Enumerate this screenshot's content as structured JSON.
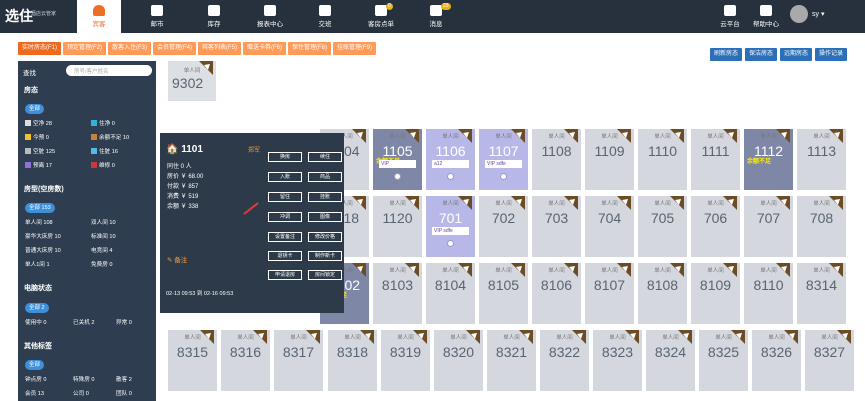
{
  "app": {
    "logo": "选住",
    "logo_sub": "酒店云管家",
    "user": "sy"
  },
  "nav": [
    {
      "label": "宾客",
      "active": true
    },
    {
      "label": "邮市"
    },
    {
      "label": "库存"
    },
    {
      "label": "报表中心"
    },
    {
      "label": "交班"
    },
    {
      "label": "客房点单",
      "badge": "0"
    },
    {
      "label": "消息",
      "badge": "23"
    }
  ],
  "nav_right": [
    "云平台",
    "帮助中心"
  ],
  "tabs": [
    "实时房态(F1)",
    "预定管理(F2)",
    "散客入住(F3)",
    "会员管理(F4)",
    "宾客列表(F5)",
    "赠送卡券(F6)",
    "保住管理(F8)",
    "挂账管理(F9)"
  ],
  "actions": [
    "刷新房态",
    "保洁房态",
    "远期房态",
    "操作记录"
  ],
  "sidebar": {
    "search_label": "查找",
    "search_placeholder": "房号/客户姓名",
    "room_status_title": "房态",
    "all": "全部",
    "status": [
      "空净 28",
      "住净 0",
      "今预 0",
      "余额不足 10",
      "空脏 125",
      "住脏 16",
      "预离 17",
      "维修 0"
    ],
    "roomtype_title": "房型(空房数)",
    "roomtype_all": "全部 153",
    "roomtypes": [
      "单人间 108",
      "双人间 10",
      "豪华大床房 10",
      "标准间 10",
      "普通大床房 10",
      "电竞间 4",
      "单人1间 1",
      "免费房 0"
    ],
    "power_title": "电脑状态",
    "power_all": "全部 2",
    "power": [
      "使用中 0",
      "已关机 2",
      "异常 0"
    ],
    "other_title": "其他标签",
    "other_all": "全部",
    "other": [
      "钟点房 0",
      "特殊房 0",
      "散客 2",
      "会员 13",
      "公司 0",
      "团队 0"
    ]
  },
  "rooms_top": {
    "type": "单人间",
    "no": "9302"
  },
  "rooms": [
    {
      "no": "1104",
      "type": "单人间"
    },
    {
      "no": "1105",
      "type": "单人间",
      "tag": "余额不足",
      "vip": "VIP"
    },
    {
      "no": "1106",
      "type": "单人间",
      "vip": "a12"
    },
    {
      "no": "1107",
      "type": "单人间",
      "vip": "VIP sdfe"
    },
    {
      "no": "1108",
      "type": "单人间"
    },
    {
      "no": "1109",
      "type": "单人间"
    },
    {
      "no": "1110",
      "type": "单人间"
    },
    {
      "no": "1111",
      "type": "单人间"
    },
    {
      "no": "1112",
      "type": "单人间",
      "tag": "余额不足"
    },
    {
      "no": "1113",
      "type": "单人间"
    },
    {
      "no": "1118",
      "type": "单人间"
    },
    {
      "no": "1120",
      "type": "单人间"
    },
    {
      "no": "701",
      "type": "单人间",
      "vip": "VIP sdfe"
    },
    {
      "no": "702",
      "type": "单人间"
    },
    {
      "no": "703",
      "type": "单人间"
    },
    {
      "no": "704",
      "type": "单人间"
    },
    {
      "no": "705",
      "type": "单人间"
    },
    {
      "no": "706",
      "type": "单人间"
    },
    {
      "no": "707",
      "type": "单人间"
    },
    {
      "no": "708",
      "type": "单人间"
    },
    {
      "no": "8102",
      "type": "单人间",
      "tag": "余额不足"
    },
    {
      "no": "8103",
      "type": "单人间"
    },
    {
      "no": "8104",
      "type": "单人间"
    },
    {
      "no": "8105",
      "type": "单人间"
    },
    {
      "no": "8106",
      "type": "单人间"
    },
    {
      "no": "8107",
      "type": "单人间"
    },
    {
      "no": "8108",
      "type": "单人间"
    },
    {
      "no": "8109",
      "type": "单人间"
    },
    {
      "no": "8110",
      "type": "单人间"
    },
    {
      "no": "8314",
      "type": "单人间"
    },
    {
      "no": "8315",
      "type": "单人间"
    },
    {
      "no": "8316",
      "type": "单人间"
    },
    {
      "no": "8317",
      "type": "单人间"
    },
    {
      "no": "8318",
      "type": "单人间"
    },
    {
      "no": "8319",
      "type": "单人间"
    },
    {
      "no": "8320",
      "type": "单人间"
    },
    {
      "no": "8321",
      "type": "单人间"
    },
    {
      "no": "8322",
      "type": "单人间"
    },
    {
      "no": "8323",
      "type": "单人间"
    },
    {
      "no": "8324",
      "type": "单人间"
    },
    {
      "no": "8325",
      "type": "单人间"
    },
    {
      "no": "8326",
      "type": "单人间"
    },
    {
      "no": "8327",
      "type": "单人间"
    }
  ],
  "popup": {
    "room": "1101",
    "flag": "郑军",
    "lines": [
      "同住 0 人",
      "房价 ￥ 68.00",
      "付款 ￥ 857",
      "消费 ￥ 519",
      "余额 ￥ 338"
    ],
    "buttons": [
      "换房",
      "续住",
      "入账",
      "商品",
      "留住",
      "挂账",
      "冲调",
      "图像",
      "设置备注",
      "修改价格",
      "退钥卡",
      "制作新卡",
      "申请退房",
      "房间锁定"
    ],
    "note": "备注",
    "dates": "02-13 09:53 到 02-16 09:53"
  }
}
